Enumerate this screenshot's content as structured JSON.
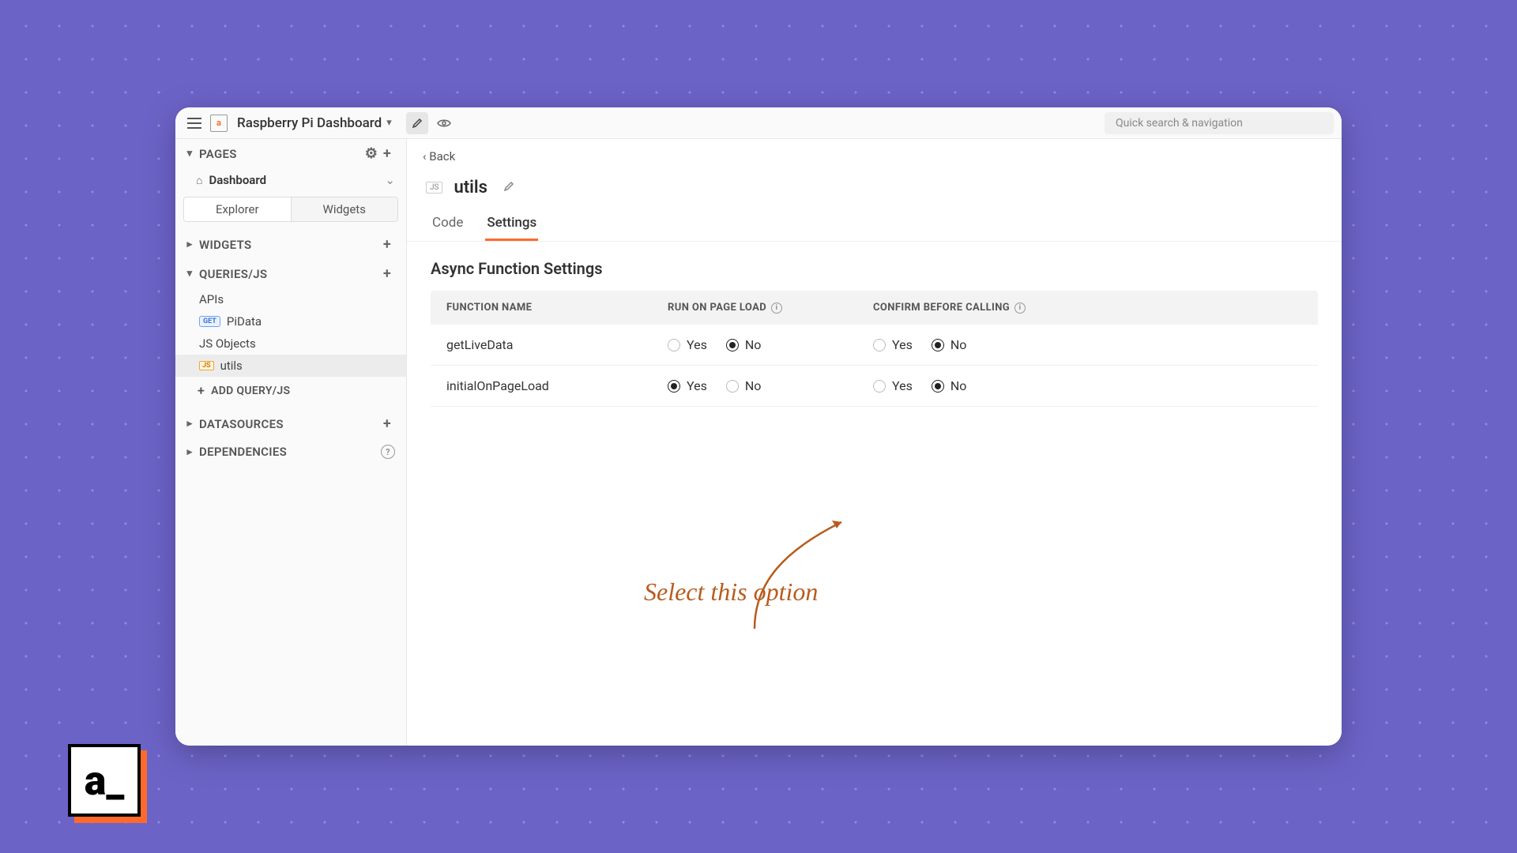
{
  "topbar": {
    "app_title": "Raspberry Pi Dashboard",
    "search_placeholder": "Quick search & navigation"
  },
  "sidebar": {
    "pages": {
      "title": "PAGES",
      "items": [
        "Dashboard"
      ]
    },
    "tabs": {
      "explorer": "Explorer",
      "widgets": "Widgets"
    },
    "widgets": {
      "title": "WIDGETS"
    },
    "queries": {
      "title": "QUERIES/JS",
      "apis_label": "APIs",
      "api_items": [
        {
          "method": "GET",
          "name": "PiData"
        }
      ],
      "js_label": "JS Objects",
      "js_items": [
        "utils"
      ],
      "add_label": "ADD QUERY/JS"
    },
    "datasources": {
      "title": "DATASOURCES"
    },
    "dependencies": {
      "title": "DEPENDENCIES"
    }
  },
  "main": {
    "back_label": "Back",
    "object_name": "utils",
    "tabs": {
      "code": "Code",
      "settings": "Settings"
    },
    "section_title": "Async Function Settings",
    "columns": {
      "name": "FUNCTION NAME",
      "run": "RUN ON PAGE LOAD",
      "confirm": "CONFIRM BEFORE CALLING"
    },
    "radio_labels": {
      "yes": "Yes",
      "no": "No"
    },
    "rows": [
      {
        "name": "getLiveData",
        "run": "No",
        "confirm": "No"
      },
      {
        "name": "initialOnPageLoad",
        "run": "Yes",
        "confirm": "No"
      }
    ]
  },
  "annotation": {
    "text": "Select this option"
  },
  "logo": {
    "text": "a_"
  }
}
